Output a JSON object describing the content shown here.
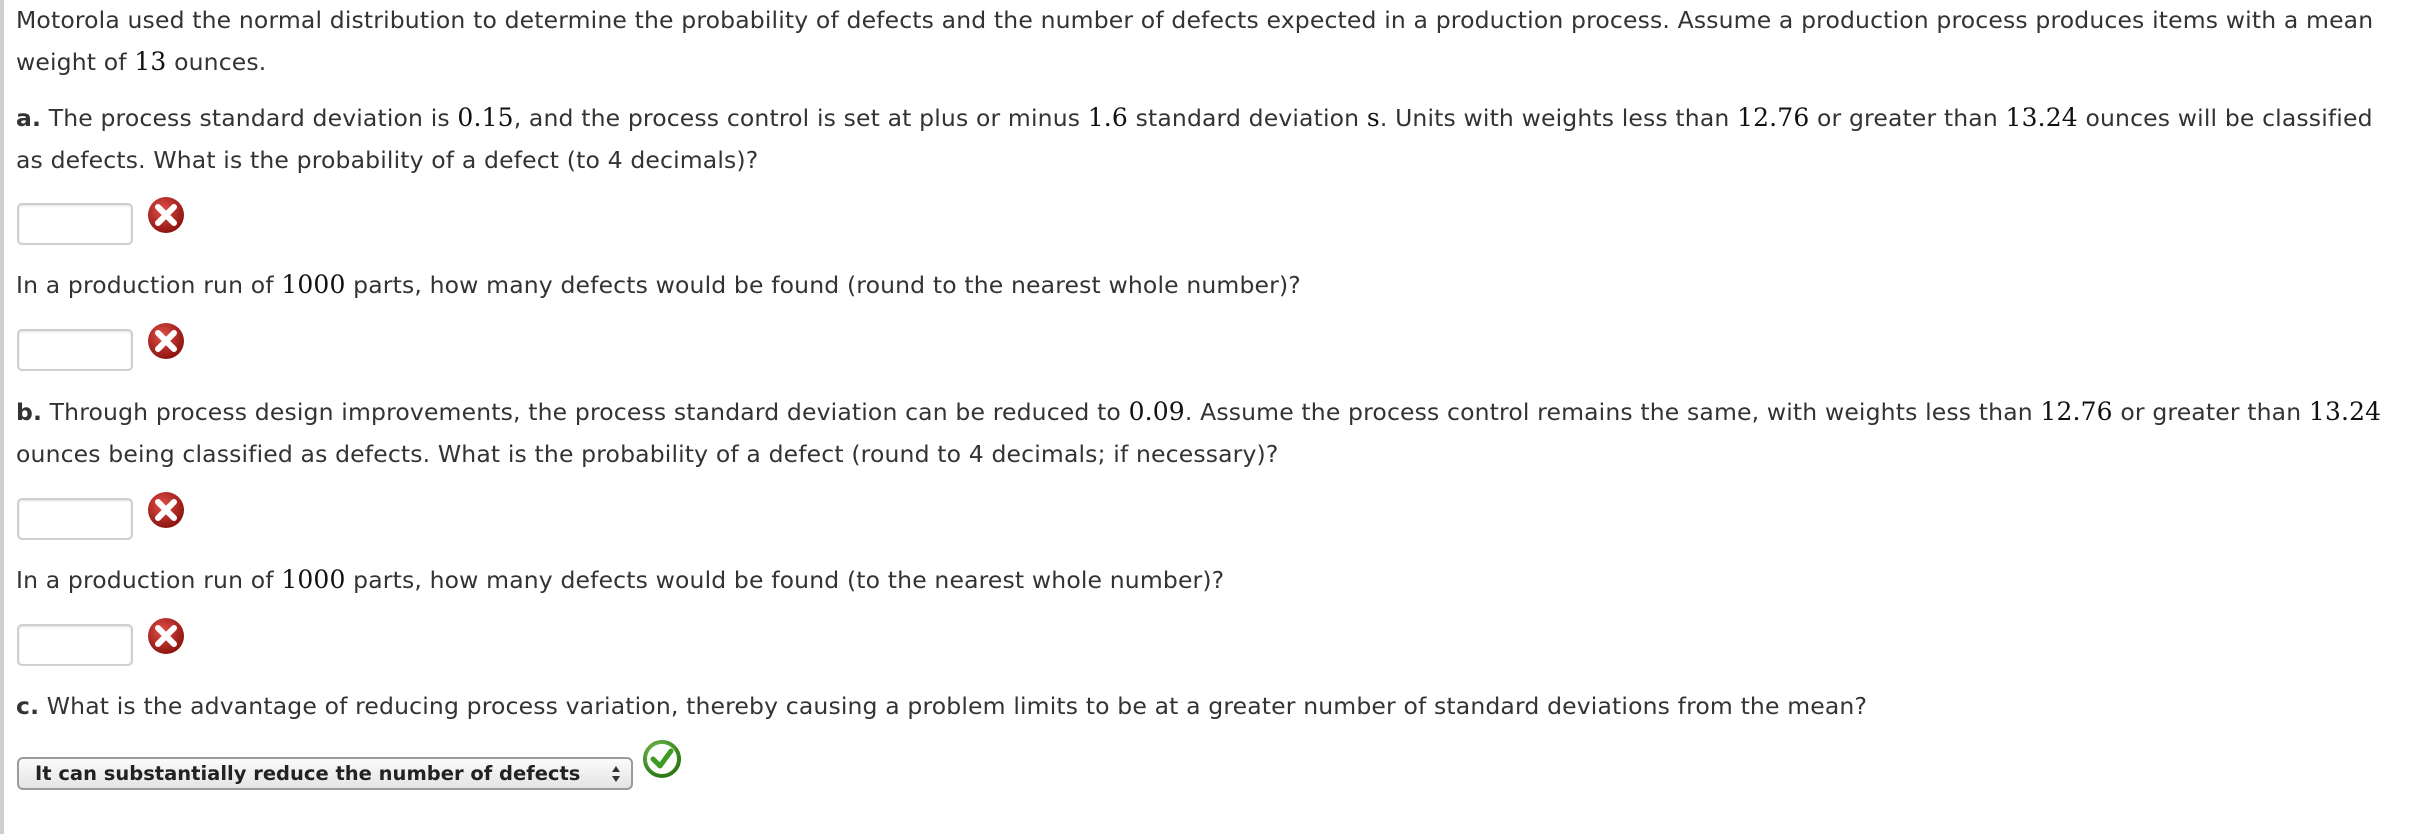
{
  "intro": {
    "line1": "Motorola used the normal distribution to determine the probability of defects and the number of defects expected in a production process. Assume a production process produces items with a mean",
    "line2_pre": "weight of ",
    "mean": "13",
    "line2_post": " ounces."
  },
  "part_a": {
    "label": "a.",
    "t1": " The process standard deviation is ",
    "sd": "0.15",
    "t2": ", and the process control is set at plus or minus ",
    "k": "1.6",
    "t3": " standard deviation ",
    "s_symbol": "s",
    "t4": ". Units with weights less than ",
    "lower": "12.76",
    "t5": " or greater than ",
    "upper": "13.24",
    "t6": " ounces will be classified",
    "line2": "as defects. What is the probability of a defect (to 4 decimals)?",
    "q1_answer": "",
    "q1_status": "incorrect",
    "q2_pre": "In a production run of ",
    "q2_run": "1000",
    "q2_post": " parts, how many defects would be found (round to the nearest whole number)?",
    "q2_answer": "",
    "q2_status": "incorrect"
  },
  "part_b": {
    "label": "b.",
    "t1": " Through process design improvements, the process standard deviation can be reduced to ",
    "sd": "0.09",
    "t2": ". Assume the process control remains the same, with weights less than ",
    "lower": "12.76",
    "t3": " or greater than ",
    "upper": "13.24",
    "line2": "ounces being classified as defects. What is the probability of a defect (round to 4 decimals; if necessary)?",
    "q1_answer": "",
    "q1_status": "incorrect",
    "q2_pre": "In a production run of ",
    "q2_run": "1000",
    "q2_post": " parts, how many defects would be found (to the nearest whole number)?",
    "q2_answer": "",
    "q2_status": "incorrect"
  },
  "part_c": {
    "label": "c.",
    "text": " What is the advantage of reducing process variation, thereby causing a problem limits to be at a greater number of standard deviations from the mean?",
    "selected_option": "It can substantially reduce the number of defects",
    "status": "correct"
  },
  "colors": {
    "incorrect": "#c0211c",
    "correct": "#3f9a22",
    "text": "#333333"
  }
}
